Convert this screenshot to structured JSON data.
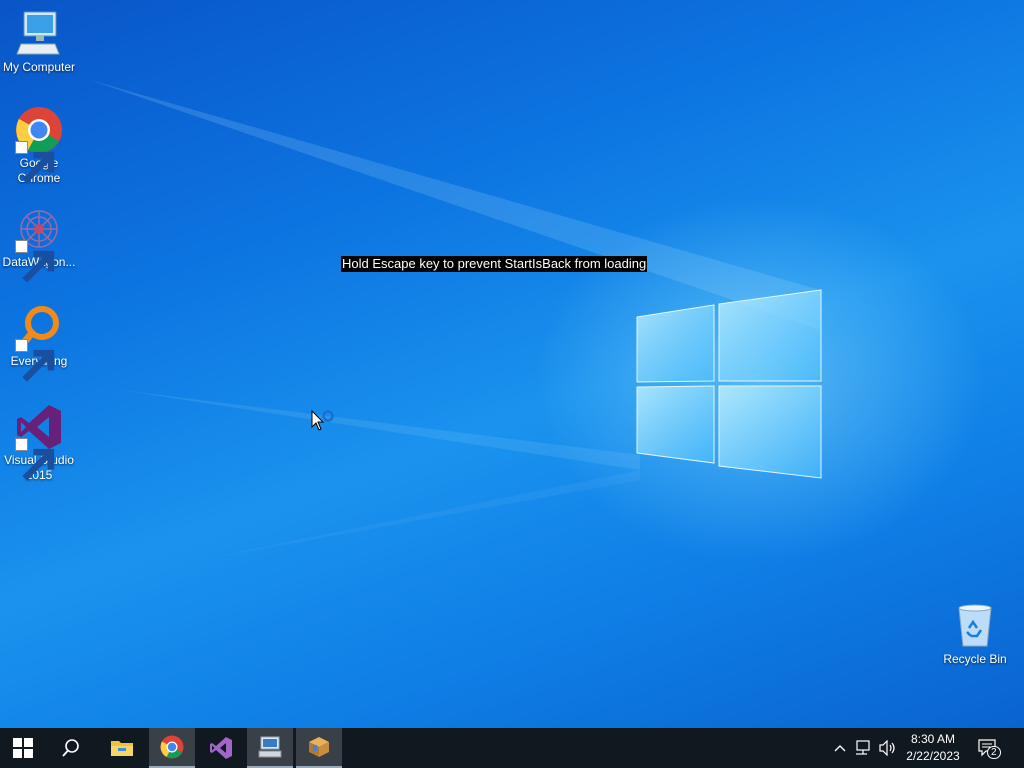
{
  "desktop": {
    "icons": [
      {
        "label": "My Computer",
        "icon": "computer-icon"
      },
      {
        "label": "Google Chrome",
        "icon": "chrome-icon"
      },
      {
        "label": "DataWagon...",
        "icon": "datawagon-icon"
      },
      {
        "label": "Everything",
        "icon": "everything-icon"
      },
      {
        "label": "Visual Studio 2015",
        "icon": "visual-studio-icon"
      },
      {
        "label": "Recycle Bin",
        "icon": "recycle-bin-icon"
      }
    ],
    "overlay_message": "Hold Escape key to prevent StartIsBack from loading"
  },
  "taskbar": {
    "pinned": [
      {
        "name": "start",
        "icon": "windows-logo-icon"
      },
      {
        "name": "search",
        "icon": "search-icon"
      },
      {
        "name": "file-explorer",
        "icon": "folder-icon"
      },
      {
        "name": "chrome",
        "icon": "chrome-icon",
        "active": true
      },
      {
        "name": "visual-studio",
        "icon": "visual-studio-icon"
      },
      {
        "name": "remote-desktop",
        "icon": "remote-desktop-icon",
        "active": true
      },
      {
        "name": "package-app",
        "icon": "package-icon",
        "active": true
      }
    ],
    "tray": {
      "time": "8:30 AM",
      "date": "2/22/2023",
      "notification_count": "2"
    }
  },
  "colors": {
    "desktop_accent": "#0c74e0",
    "taskbar_bg": "#101820",
    "vs_purple": "#68217a"
  }
}
